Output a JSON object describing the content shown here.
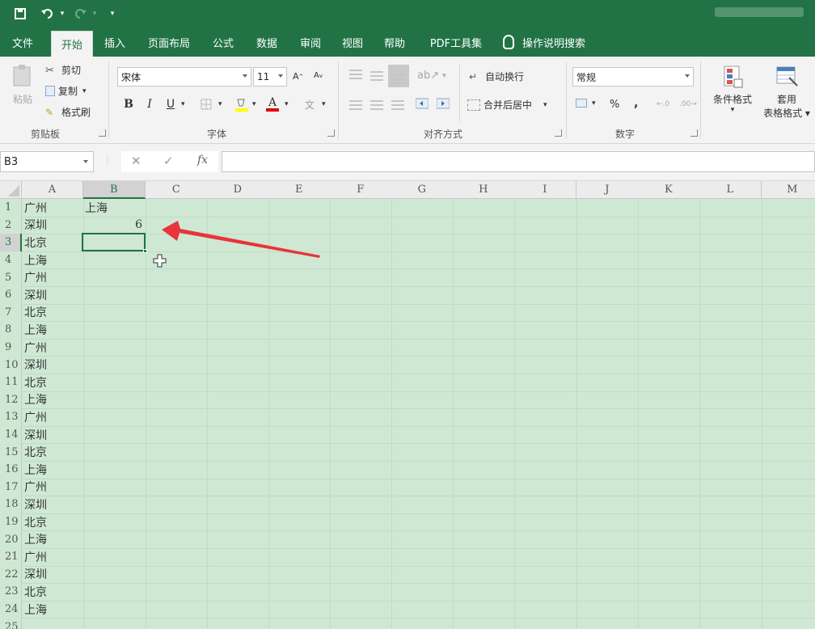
{
  "quick_access": {
    "save_icon": "save-icon",
    "undo_icon": "undo-icon",
    "redo_icon": "redo-icon",
    "customize_icon": "customize-icon"
  },
  "tabs": [
    {
      "label": "文件",
      "active": false
    },
    {
      "label": "开始",
      "active": true
    },
    {
      "label": "插入",
      "active": false
    },
    {
      "label": "页面布局",
      "active": false
    },
    {
      "label": "公式",
      "active": false
    },
    {
      "label": "数据",
      "active": false
    },
    {
      "label": "审阅",
      "active": false
    },
    {
      "label": "视图",
      "active": false
    },
    {
      "label": "帮助",
      "active": false
    },
    {
      "label": "PDF工具集",
      "active": false
    }
  ],
  "tell_me": "操作说明搜索",
  "clipboard": {
    "paste": "粘贴",
    "cut": "剪切",
    "copy": "复制",
    "format_painter": "格式刷",
    "group": "剪贴板"
  },
  "font": {
    "name": "宋体",
    "size": "11",
    "bold": "B",
    "italic": "I",
    "underline": "U",
    "color": "A",
    "group": "字体"
  },
  "alignment": {
    "wrap_text": "自动换行",
    "merge_center": "合并后居中",
    "group": "对齐方式"
  },
  "number": {
    "format": "常规",
    "percent": "%",
    "comma": ",",
    "group": "数字"
  },
  "styles": {
    "conditional_formatting": "条件格式",
    "format_as_table_line1": "套用",
    "format_as_table_line2": "表格格式"
  },
  "formula_bar": {
    "name_box": "B3",
    "cancel": "✕",
    "enter": "✓",
    "fx": "fx",
    "content": ""
  },
  "sheet": {
    "columns": [
      "A",
      "B",
      "C",
      "D",
      "E",
      "F",
      "G",
      "H",
      "I",
      "J",
      "K",
      "L",
      "M"
    ],
    "selected_column": "B",
    "rows": [
      "1",
      "2",
      "3",
      "4",
      "5",
      "6",
      "7",
      "8",
      "9",
      "10",
      "11",
      "12",
      "13",
      "14",
      "15",
      "16",
      "17",
      "18",
      "19",
      "20",
      "21",
      "22",
      "23",
      "24",
      "25"
    ],
    "selected_row": "3",
    "col_a": [
      "广州",
      "深圳",
      "北京",
      "上海",
      "广州",
      "深圳",
      "北京",
      "上海",
      "广州",
      "深圳",
      "北京",
      "上海",
      "广州",
      "深圳",
      "北京",
      "上海",
      "广州",
      "深圳",
      "北京",
      "上海",
      "广州",
      "深圳",
      "北京",
      "上海"
    ],
    "b1": "上海",
    "b2": "6",
    "active_cell": "B3"
  },
  "colors": {
    "brand": "#217346",
    "sheet_fill": "#cfe8d3",
    "annotation": "#e8343a"
  }
}
